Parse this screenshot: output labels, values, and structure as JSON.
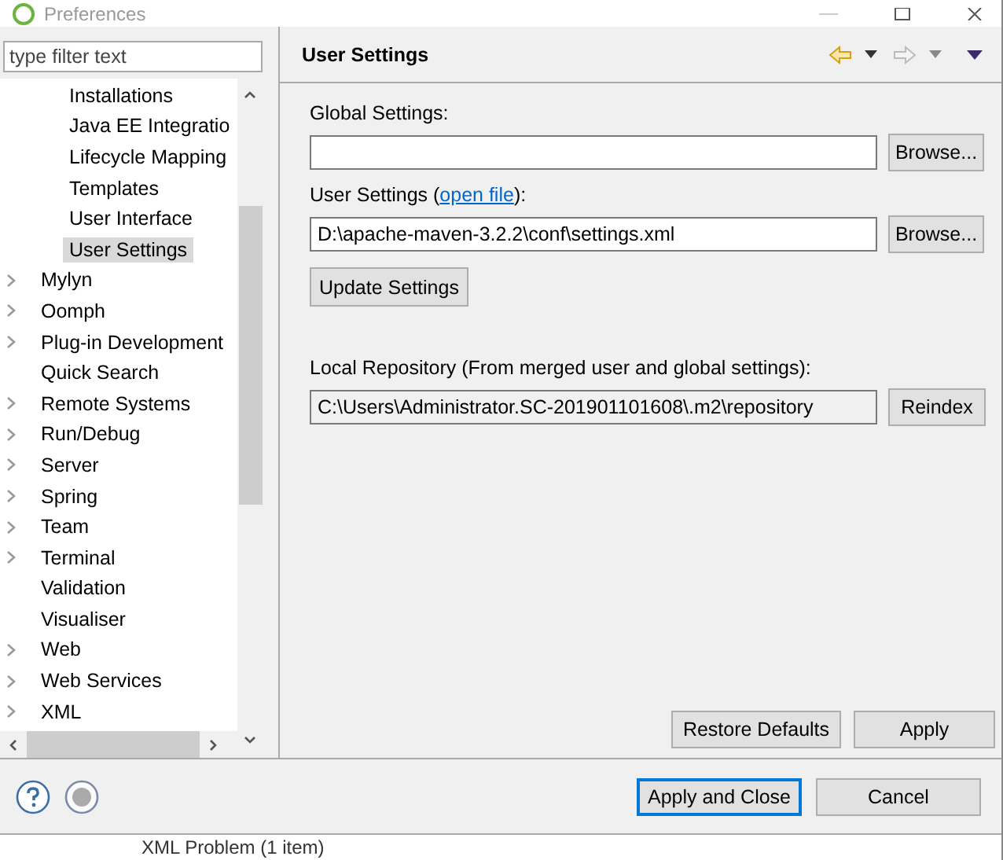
{
  "window": {
    "title": "Preferences"
  },
  "filter": {
    "placeholder": "type filter text"
  },
  "tree": {
    "nested_items": [
      {
        "label": "Installations",
        "selected": false
      },
      {
        "label": "Java EE Integratio",
        "selected": false
      },
      {
        "label": "Lifecycle Mapping",
        "selected": false
      },
      {
        "label": "Templates",
        "selected": false
      },
      {
        "label": "User Interface",
        "selected": false
      },
      {
        "label": "User Settings",
        "selected": true
      }
    ],
    "items": [
      {
        "label": "Mylyn",
        "kind": "folder",
        "selected": false
      },
      {
        "label": "Oomph",
        "kind": "folder",
        "selected": false
      },
      {
        "label": "Plug-in Development",
        "kind": "folder",
        "selected": false
      },
      {
        "label": "Quick Search",
        "kind": "leaf",
        "selected": false
      },
      {
        "label": "Remote Systems",
        "kind": "folder",
        "selected": false
      },
      {
        "label": "Run/Debug",
        "kind": "folder",
        "selected": false
      },
      {
        "label": "Server",
        "kind": "folder",
        "selected": false
      },
      {
        "label": "Spring",
        "kind": "folder",
        "selected": false
      },
      {
        "label": "Team",
        "kind": "folder",
        "selected": false
      },
      {
        "label": "Terminal",
        "kind": "folder",
        "selected": false
      },
      {
        "label": "Validation",
        "kind": "leaf",
        "selected": false
      },
      {
        "label": "Visualiser",
        "kind": "leaf",
        "selected": false
      },
      {
        "label": "Web",
        "kind": "folder",
        "selected": false
      },
      {
        "label": "Web Services",
        "kind": "folder",
        "selected": false
      },
      {
        "label": "XML",
        "kind": "folder",
        "selected": false
      }
    ]
  },
  "page": {
    "title": "User Settings",
    "back_enabled": true,
    "forward_enabled": false,
    "global_label": "Global Settings:",
    "global_browse": "Browse...",
    "user_label_before": "User Settings (",
    "user_link": "open file",
    "user_label_after": "):",
    "user_value": "D:\\apache-maven-3.2.2\\conf\\settings.xml",
    "user_browse": "Browse...",
    "update_button": "Update Settings",
    "repo_label": "Local Repository (From merged user and global settings):",
    "repo_value": "C:\\Users\\Administrator.SC-201901101608\\.m2\\repository",
    "reindex_button": "Reindex",
    "restore_button": "Restore Defaults",
    "apply_button": "Apply"
  },
  "footer": {
    "buttons": [
      {
        "label": "Apply and Close",
        "default": true
      },
      {
        "label": "Cancel",
        "default": false
      }
    ]
  },
  "behind": {
    "text": "XML Problem (1 item)"
  }
}
